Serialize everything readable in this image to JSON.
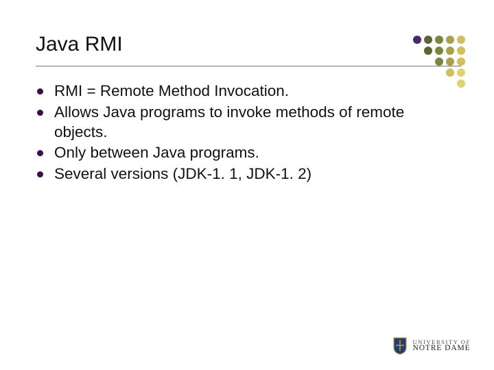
{
  "colors": {
    "bullet": "#3b0d52",
    "rule": "#777777"
  },
  "title": "Java RMI",
  "bullets": [
    "RMI = Remote Method Invocation.",
    "Allows Java programs to invoke methods of remote objects.",
    "Only between Java programs.",
    "Several versions (JDK-1. 1, JDK-1. 2)"
  ],
  "logo": {
    "line1": "UNIVERSITY OF",
    "line2": "NOTRE DAME"
  }
}
